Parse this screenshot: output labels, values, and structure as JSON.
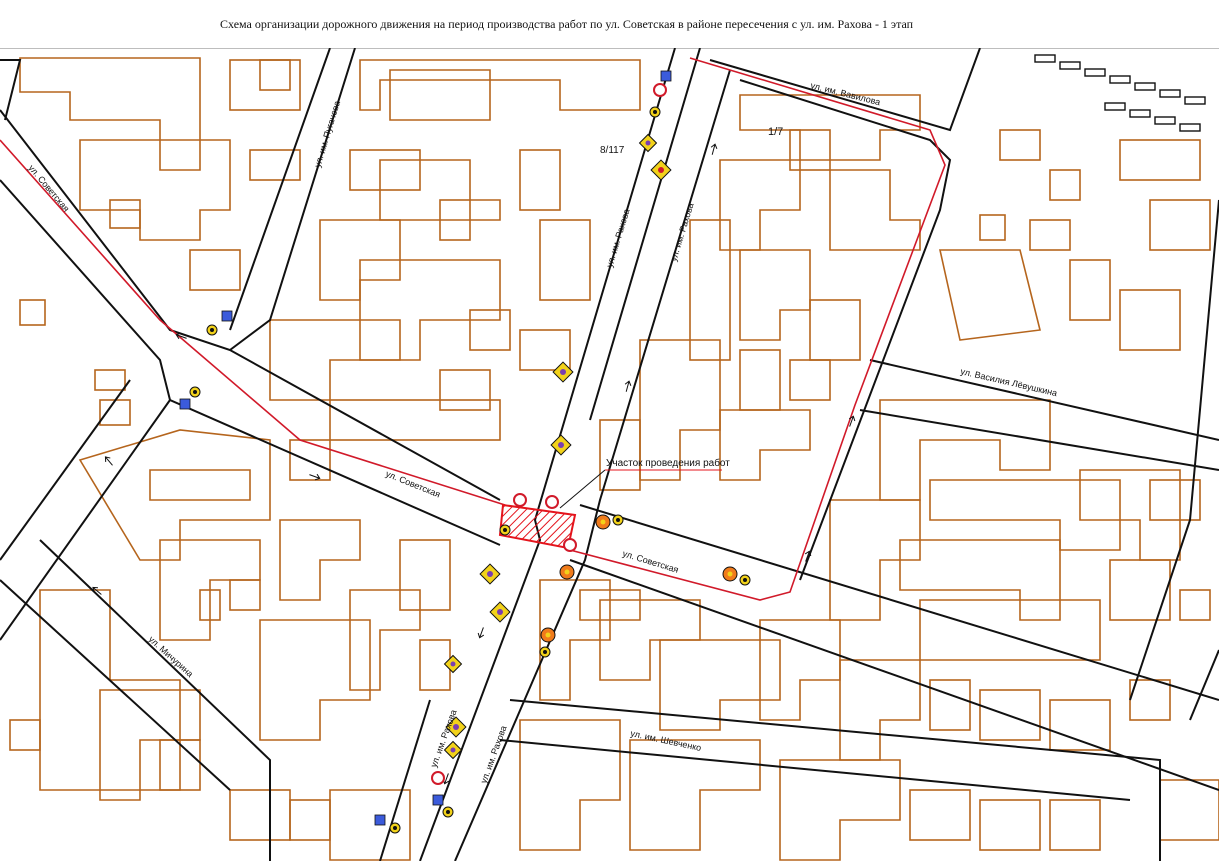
{
  "title": "Схема организации дорожного движения на период производства работ по ул. Советская в районе пересечения с ул. им.  Рахова - 1 этап",
  "streets": {
    "sovetskaya_nw": "ул. Советская",
    "sovetskaya_mid": "ул. Советская",
    "sovetskaya_e": "ул. Советская",
    "rakhova_n_left": "ул. им. Рахова",
    "rakhova_n_right": "ул. им. Рахова",
    "rakhova_s_left": "ул. им. Рахова",
    "rakhova_s_right": "ул. им. Рахова",
    "pugacheva": "ул. им. Пугачева",
    "vavilova": "ул. им. Вавилова",
    "lyovushkina": "ул. Василия Лёвушкина",
    "michurina": "ул. Мичурина",
    "shevchenko": "ул. им. Шевченко"
  },
  "building_labels": {
    "b117": "8/117",
    "b17": "1/7"
  },
  "work_zone": {
    "label": "Участок проведения работ",
    "color": "#e4141c"
  },
  "colors": {
    "building_outline": "#b5651d",
    "road_edge": "#111111",
    "route_line": "#d11a2a",
    "hatch": "#e4141c",
    "sign_yellow": "#f2d21a"
  },
  "icons": [
    "detour-arrow-icon",
    "road-work-sign-icon",
    "no-entry-sign-icon",
    "direction-sign-icon",
    "barrier-lamp-icon"
  ]
}
